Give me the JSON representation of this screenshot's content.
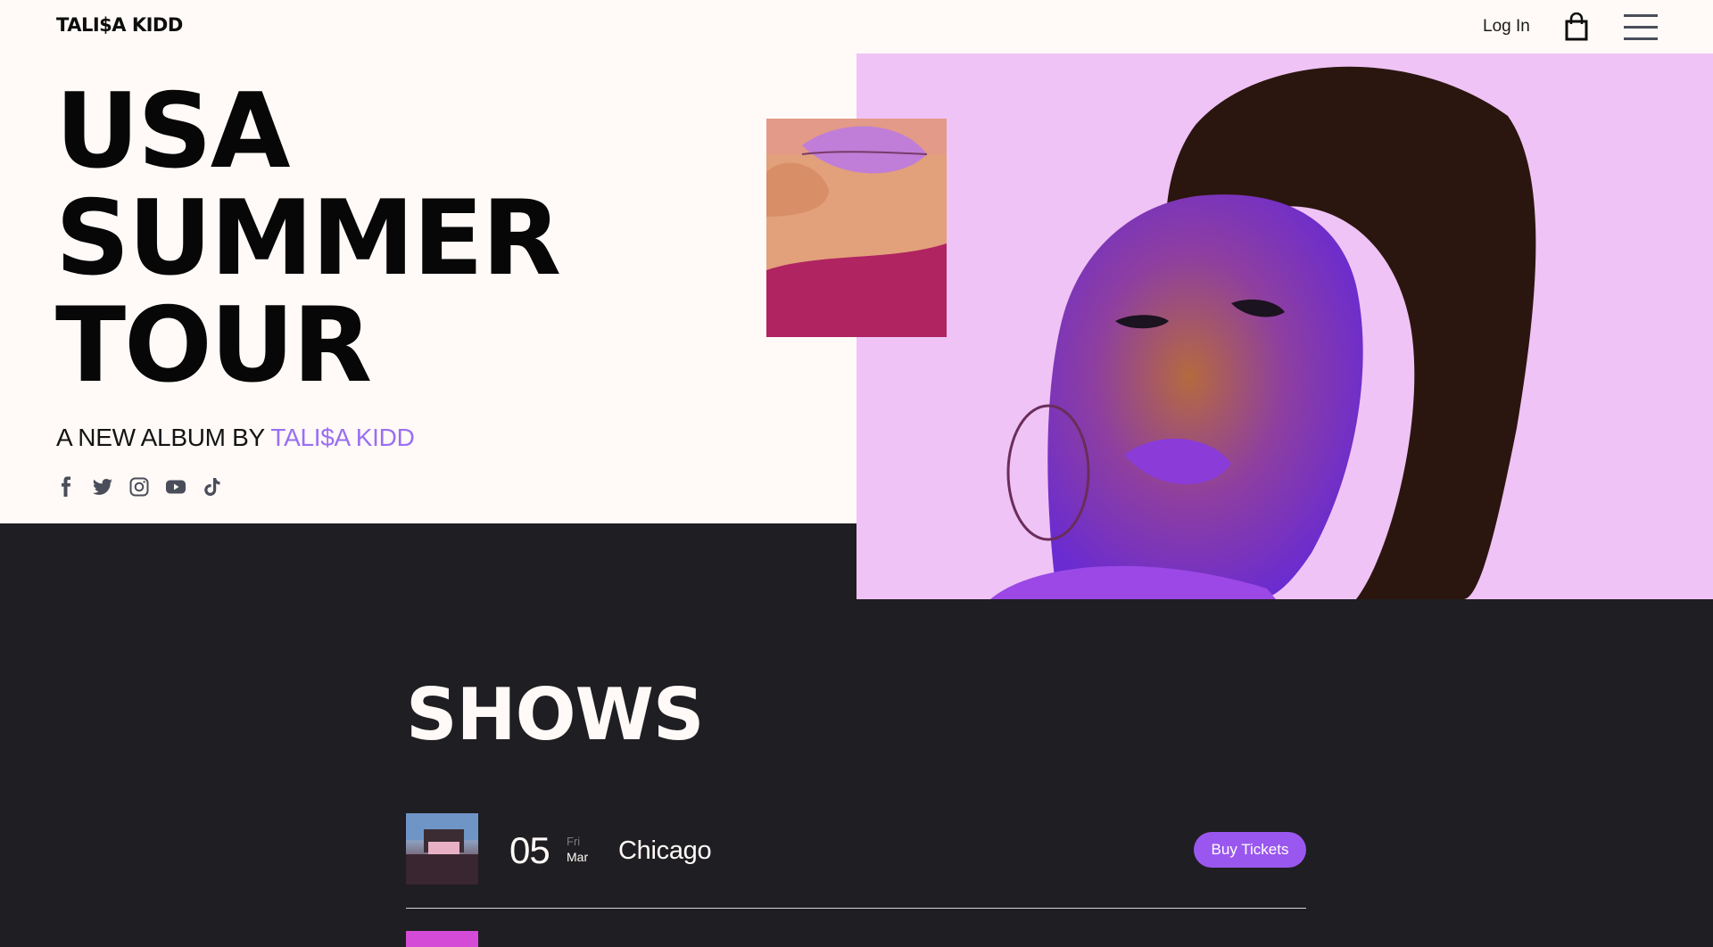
{
  "header": {
    "logo": "TALI$A KIDD",
    "login_label": "Log In",
    "cart_icon": "shopping-bag-icon",
    "menu_icon": "hamburger-menu-icon"
  },
  "hero": {
    "title_lines": [
      "USA",
      "SUMMER",
      "TOUR"
    ],
    "album_prefix": "A NEW ALBUM BY",
    "album_artist": "TALI$A KIDD",
    "socials": [
      "facebook-icon",
      "twitter-icon",
      "instagram-icon",
      "youtube-icon",
      "tiktok-icon"
    ],
    "accent_color": "#9a6ff2"
  },
  "shows": {
    "title": "SHOWS",
    "items": [
      {
        "day": "05",
        "weekday": "Fri",
        "month": "Mar",
        "city": "Chicago",
        "button_label": "Buy Tickets"
      }
    ]
  },
  "colors": {
    "background": "#fffaf7",
    "dark_section": "#1f1e22",
    "button": "#9a57ef"
  }
}
